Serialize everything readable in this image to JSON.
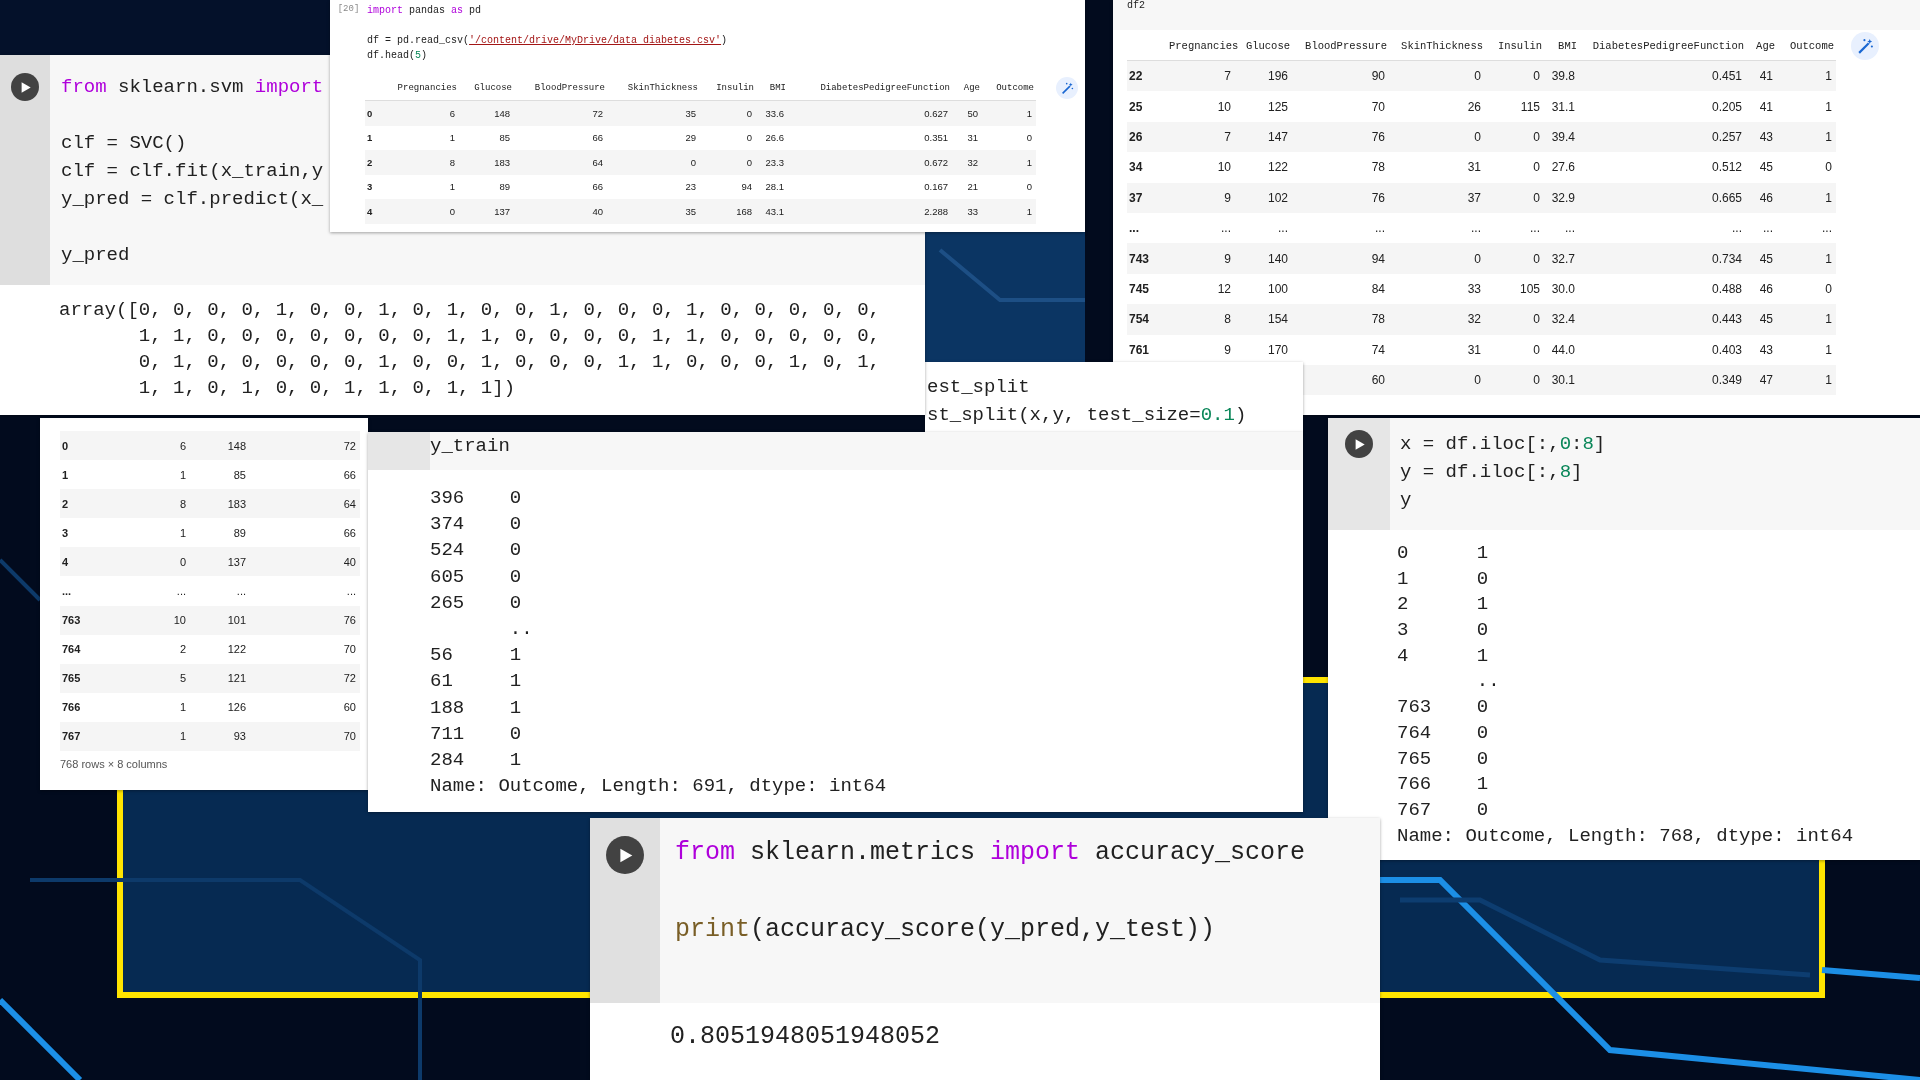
{
  "pieces": [
    {
      "kind": "code_cell",
      "run_button": true,
      "code_blocks": [
        {
          "lines": [
            {
              "tokens": [
                {
                  "text": "from",
                  "kind": "keyword"
                },
                {
                  "text": " sklearn.svm ",
                  "kind": "plain"
                },
                {
                  "text": "import",
                  "kind": "keyword"
                }
              ]
            }
          ]
        },
        {
          "lines": [
            {
              "text": "clf = SVC()"
            },
            {
              "text": "clf = clf.fit(x_train,y"
            },
            {
              "text": "y_pred = clf.predict(x_"
            }
          ]
        },
        {
          "lines": [
            {
              "text": "y_pred"
            }
          ]
        }
      ],
      "output": {
        "kind": "text",
        "lines": [
          "array([0, 0, 0, 0, 1, 0, 0, 1, 0, 1, 0, 0, 1, 0, 0, 0, 1, 0, 0, 0, 0, 0,",
          "       1, 1, 0, 0, 0, 0, 0, 0, 0, 1, 1, 0, 0, 0, 0, 1, 1, 0, 0, 0, 0, 0,",
          "       0, 1, 0, 0, 0, 0, 0, 1, 0, 0, 1, 0, 0, 0, 1, 1, 0, 0, 0, 1, 0, 1,",
          "       1, 1, 0, 1, 0, 0, 1, 1, 0, 1, 1])"
        ]
      }
    },
    {
      "kind": "code_cell",
      "execution_count": "[20]",
      "code_blocks": [
        {
          "lines": [
            {
              "tokens": [
                {
                  "text": "import",
                  "kind": "keyword"
                },
                {
                  "text": " pandas ",
                  "kind": "plain"
                },
                {
                  "text": "as",
                  "kind": "keyword"
                },
                {
                  "text": " pd",
                  "kind": "plain"
                }
              ]
            }
          ]
        },
        {
          "lines": [
            {
              "tokens": [
                {
                  "text": "df = pd.read_csv(",
                  "kind": "plain"
                },
                {
                  "text": "'/content/drive/MyDrive/data diabetes.csv'",
                  "kind": "string"
                },
                {
                  "text": ")",
                  "kind": "plain"
                }
              ]
            },
            {
              "tokens": [
                {
                  "text": "df.head(",
                  "kind": "plain"
                },
                {
                  "text": "5",
                  "kind": "number"
                },
                {
                  "text": ")",
                  "kind": "plain"
                }
              ]
            }
          ]
        }
      ],
      "output": {
        "kind": "table",
        "wand_button": true,
        "columns": [
          "",
          "Pregnancies",
          "Glucose",
          "BloodPressure",
          "SkinThickness",
          "Insulin",
          "BMI",
          "DiabetesPedigreeFunction",
          "Age",
          "Outcome"
        ],
        "rows": [
          [
            "0",
            "6",
            "148",
            "72",
            "35",
            "0",
            "33.6",
            "0.627",
            "50",
            "1"
          ],
          [
            "1",
            "1",
            "85",
            "66",
            "29",
            "0",
            "26.6",
            "0.351",
            "31",
            "0"
          ],
          [
            "2",
            "8",
            "183",
            "64",
            "0",
            "0",
            "23.3",
            "0.672",
            "32",
            "1"
          ],
          [
            "3",
            "1",
            "89",
            "66",
            "23",
            "94",
            "28.1",
            "0.167",
            "21",
            "0"
          ],
          [
            "4",
            "0",
            "137",
            "40",
            "35",
            "168",
            "43.1",
            "2.288",
            "33",
            "1"
          ]
        ]
      }
    },
    {
      "kind": "code_cell",
      "code_blocks": [
        {
          "lines": [
            {
              "text": "df2"
            }
          ]
        }
      ],
      "output": {
        "kind": "table",
        "wand_button": true,
        "columns": [
          "",
          "Pregnancies",
          "Glucose",
          "BloodPressure",
          "SkinThickness",
          "Insulin",
          "BMI",
          "DiabetesPedigreeFunction",
          "Age",
          "Outcome"
        ],
        "rows": [
          [
            "22",
            "7",
            "196",
            "90",
            "0",
            "0",
            "39.8",
            "0.451",
            "41",
            "1"
          ],
          [
            "25",
            "10",
            "125",
            "70",
            "26",
            "115",
            "31.1",
            "0.205",
            "41",
            "1"
          ],
          [
            "26",
            "7",
            "147",
            "76",
            "0",
            "0",
            "39.4",
            "0.257",
            "43",
            "1"
          ],
          [
            "34",
            "10",
            "122",
            "78",
            "31",
            "0",
            "27.6",
            "0.512",
            "45",
            "0"
          ],
          [
            "37",
            "9",
            "102",
            "76",
            "37",
            "0",
            "32.9",
            "0.665",
            "46",
            "1"
          ],
          [
            "...",
            "...",
            "...",
            "...",
            "...",
            "...",
            "...",
            "...",
            "...",
            "..."
          ],
          [
            "743",
            "9",
            "140",
            "94",
            "0",
            "0",
            "32.7",
            "0.734",
            "45",
            "1"
          ],
          [
            "745",
            "12",
            "100",
            "84",
            "33",
            "105",
            "30.0",
            "0.488",
            "46",
            "0"
          ],
          [
            "754",
            "8",
            "154",
            "78",
            "32",
            "0",
            "32.4",
            "0.443",
            "45",
            "1"
          ],
          [
            "761",
            "9",
            "170",
            "74",
            "31",
            "0",
            "44.0",
            "0.403",
            "43",
            "1"
          ],
          [
            null,
            null,
            null,
            "60",
            "0",
            "0",
            "30.1",
            "0.349",
            "47",
            "1"
          ]
        ]
      }
    },
    {
      "kind": "code_cell",
      "code_blocks": [
        {
          "lines": [
            {
              "text": "est_split"
            },
            {
              "tokens": [
                {
                  "text": "st_split(x,y, test_size=",
                  "kind": "plain"
                },
                {
                  "text": "0.1",
                  "kind": "number"
                },
                {
                  "text": ")",
                  "kind": "plain"
                }
              ]
            }
          ]
        }
      ]
    },
    {
      "kind": "code_cell",
      "output": {
        "kind": "table",
        "summary": "768 rows × 8 columns",
        "rows": [
          [
            "0",
            "6",
            "148",
            "72"
          ],
          [
            "1",
            "1",
            "85",
            "66"
          ],
          [
            "2",
            "8",
            "183",
            "64"
          ],
          [
            "3",
            "1",
            "89",
            "66"
          ],
          [
            "4",
            "0",
            "137",
            "40"
          ],
          [
            "...",
            "...",
            "...",
            "..."
          ],
          [
            "763",
            "10",
            "101",
            "76"
          ],
          [
            "764",
            "2",
            "122",
            "70"
          ],
          [
            "765",
            "5",
            "121",
            "72"
          ],
          [
            "766",
            "1",
            "126",
            "60"
          ],
          [
            "767",
            "1",
            "93",
            "70"
          ]
        ]
      }
    },
    {
      "kind": "code_cell",
      "code_blocks": [
        {
          "lines": [
            {
              "text": "y_train"
            }
          ]
        }
      ],
      "output": {
        "kind": "text",
        "lines": [
          "396    0",
          "374    0",
          "524    0",
          "605    0",
          "265    0",
          "       ..",
          "56     1",
          "61     1",
          "188    1",
          "711    0",
          "284    1",
          "Name: Outcome, Length: 691, dtype: int64"
        ]
      }
    },
    {
      "kind": "code_cell",
      "run_button": true,
      "code_blocks": [
        {
          "lines": [
            {
              "tokens": [
                {
                  "text": "x = df.iloc[:,",
                  "kind": "plain"
                },
                {
                  "text": "0",
                  "kind": "number"
                },
                {
                  "text": ":",
                  "kind": "plain"
                },
                {
                  "text": "8",
                  "kind": "number"
                },
                {
                  "text": "]",
                  "kind": "plain"
                }
              ]
            },
            {
              "tokens": [
                {
                  "text": "y = df.iloc[:,",
                  "kind": "plain"
                },
                {
                  "text": "8",
                  "kind": "number"
                },
                {
                  "text": "]",
                  "kind": "plain"
                }
              ]
            },
            {
              "text": "y"
            }
          ]
        }
      ],
      "output": {
        "kind": "text",
        "lines": [
          "0      1",
          "1      0",
          "2      1",
          "3      0",
          "4      1",
          "       ..",
          "763    0",
          "764    0",
          "765    0",
          "766    1",
          "767    0",
          "Name: Outcome, Length: 768, dtype: int64"
        ]
      }
    },
    {
      "kind": "code_cell",
      "run_button": true,
      "code_blocks": [
        {
          "lines": [
            {
              "tokens": [
                {
                  "text": "from",
                  "kind": "keyword"
                },
                {
                  "text": " sklearn.metrics ",
                  "kind": "plain"
                },
                {
                  "text": "import",
                  "kind": "keyword"
                },
                {
                  "text": " accuracy_score",
                  "kind": "plain"
                }
              ]
            }
          ]
        },
        {
          "lines": [
            {
              "tokens": [
                {
                  "text": "print",
                  "kind": "function"
                },
                {
                  "text": "(accuracy_score(y_pred,y_test))",
                  "kind": "plain"
                }
              ]
            }
          ]
        }
      ],
      "output": {
        "kind": "text",
        "lines": [
          "0.8051948051948052"
        ]
      }
    }
  ]
}
